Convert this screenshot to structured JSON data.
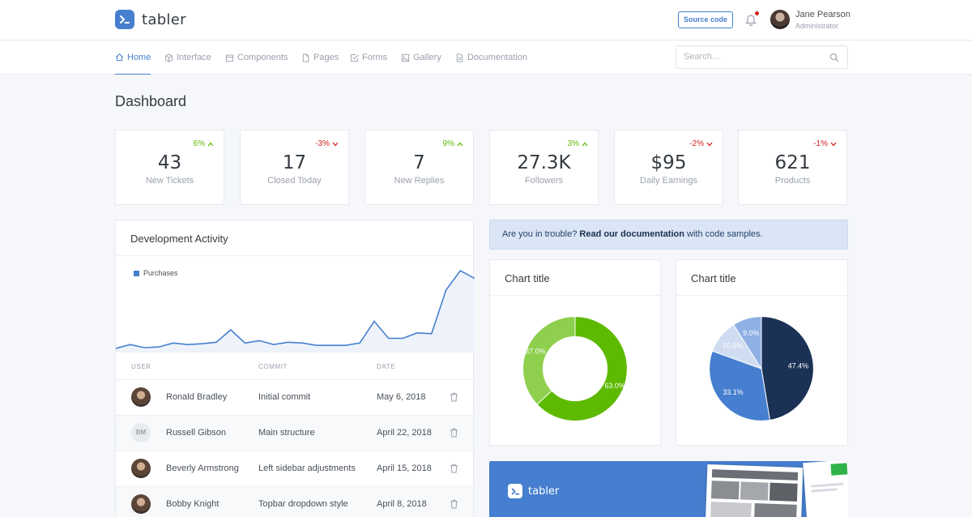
{
  "header": {
    "logo_text": "tabler",
    "source_button": "Source code",
    "user": {
      "name": "Jane Pearson",
      "role": "Administrator"
    }
  },
  "nav": {
    "items": [
      {
        "label": "Home",
        "icon": "home-icon",
        "active": true
      },
      {
        "label": "Interface",
        "icon": "box-icon"
      },
      {
        "label": "Components",
        "icon": "calendar-icon"
      },
      {
        "label": "Pages",
        "icon": "file-icon"
      },
      {
        "label": "Forms",
        "icon": "check-square-icon"
      },
      {
        "label": "Gallery",
        "icon": "image-icon"
      },
      {
        "label": "Documentation",
        "icon": "file-text-icon"
      }
    ],
    "search_placeholder": "Search…"
  },
  "page_title": "Dashboard",
  "stats": [
    {
      "change": "6%",
      "direction": "up",
      "value": "43",
      "label": "New Tickets"
    },
    {
      "change": "-3%",
      "direction": "down",
      "value": "17",
      "label": "Closed Today"
    },
    {
      "change": "9%",
      "direction": "up",
      "value": "7",
      "label": "New Replies"
    },
    {
      "change": "3%",
      "direction": "up",
      "value": "27.3K",
      "label": "Followers"
    },
    {
      "change": "-2%",
      "direction": "down",
      "value": "$95",
      "label": "Daily Earnings"
    },
    {
      "change": "-1%",
      "direction": "down",
      "value": "621",
      "label": "Products"
    }
  ],
  "dev_activity": {
    "title": "Development Activity",
    "columns": [
      "USER",
      "COMMIT",
      "DATE"
    ],
    "rows": [
      {
        "user": "Ronald Bradley",
        "avatar": "photo",
        "commit": "Initial commit",
        "date": "May 6, 2018"
      },
      {
        "user": "Russell Gibson",
        "avatar": "BM",
        "commit": "Main structure",
        "date": "April 22, 2018"
      },
      {
        "user": "Beverly Armstrong",
        "avatar": "photo",
        "commit": "Left sidebar adjustments",
        "date": "April 15, 2018"
      },
      {
        "user": "Bobby Knight",
        "avatar": "photo",
        "commit": "Topbar dropdown style",
        "date": "April 8, 2018"
      }
    ]
  },
  "chart_data": [
    {
      "type": "area",
      "series": [
        {
          "name": "Purchases",
          "values": [
            0,
            5,
            1,
            2,
            7,
            5,
            6,
            8,
            24,
            7,
            10,
            5,
            8,
            7,
            4,
            4,
            4,
            7,
            35,
            13,
            13,
            20,
            19,
            75,
            100,
            90
          ]
        }
      ],
      "grid": false,
      "legend": "top-left",
      "color": "#467fcf"
    },
    {
      "type": "pie",
      "title": "Chart title",
      "donut": true,
      "slices": [
        {
          "label": "63.0%",
          "value": 63.0,
          "color": "#5eba00"
        },
        {
          "label": "37.0%",
          "value": 37.0,
          "color": "#8ecf4d"
        }
      ]
    },
    {
      "type": "pie",
      "title": "Chart title",
      "donut": false,
      "slices": [
        {
          "label": "47.4%",
          "value": 47.4,
          "color": "#1b3155"
        },
        {
          "label": "33.1%",
          "value": 33.1,
          "color": "#467fcf"
        },
        {
          "label": "10.5%",
          "value": 10.5,
          "color": "#cfdcf2"
        },
        {
          "label": "9.0%",
          "value": 9.0,
          "color": "#8fb0e3"
        }
      ]
    }
  ],
  "alert": {
    "prefix": "Are you in trouble?",
    "link": "Read our documentation",
    "suffix": "with code samples."
  },
  "banner": {
    "logo_text": "tabler"
  }
}
